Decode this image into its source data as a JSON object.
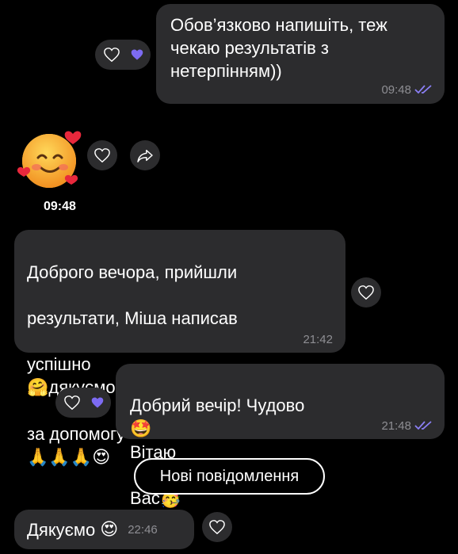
{
  "colors": {
    "background": "#000000",
    "bubble": "#2c2c2e",
    "accent": "#8b7ff5",
    "muted": "#8e8e93"
  },
  "messages": [
    {
      "direction": "outgoing",
      "text": "Обов’язково напишіть, теж\nчекаю результатів з\nнетерпінням))",
      "time": "09:48",
      "status_icon": "double-check-icon",
      "reactions": [
        "heart-outline-icon",
        "purple-heart-icon"
      ]
    },
    {
      "direction": "incoming",
      "sticker": "smiling-face-with-hearts",
      "time": "09:48",
      "actions": [
        "heart-outline-icon",
        "share-arrow-icon"
      ]
    },
    {
      "direction": "incoming",
      "text_lines": [
        "Доброго вечора, прийшли",
        "результати, Міша написав",
        "успішно",
        "дякуємо вам велике",
        "за допомогу"
      ],
      "emojis": [
        "🤗",
        "🙏🙏🙏",
        "😍"
      ],
      "time": "21:42",
      "reaction": "heart-outline-icon"
    },
    {
      "direction": "outgoing",
      "text_parts": [
        "Добрий вечір! Чудово",
        "Вітаю",
        "Вас"
      ],
      "emojis": [
        "🤩",
        "🥳"
      ],
      "time": "21:48",
      "status_icon": "double-check-icon",
      "reactions": [
        "heart-outline-icon",
        "purple-heart-icon"
      ]
    },
    {
      "direction": "incoming",
      "text": "Дякуємо",
      "emoji": "😍",
      "time": "22:46",
      "reaction": "heart-outline-icon"
    }
  ],
  "new_messages_button": "Нові повідомлення"
}
